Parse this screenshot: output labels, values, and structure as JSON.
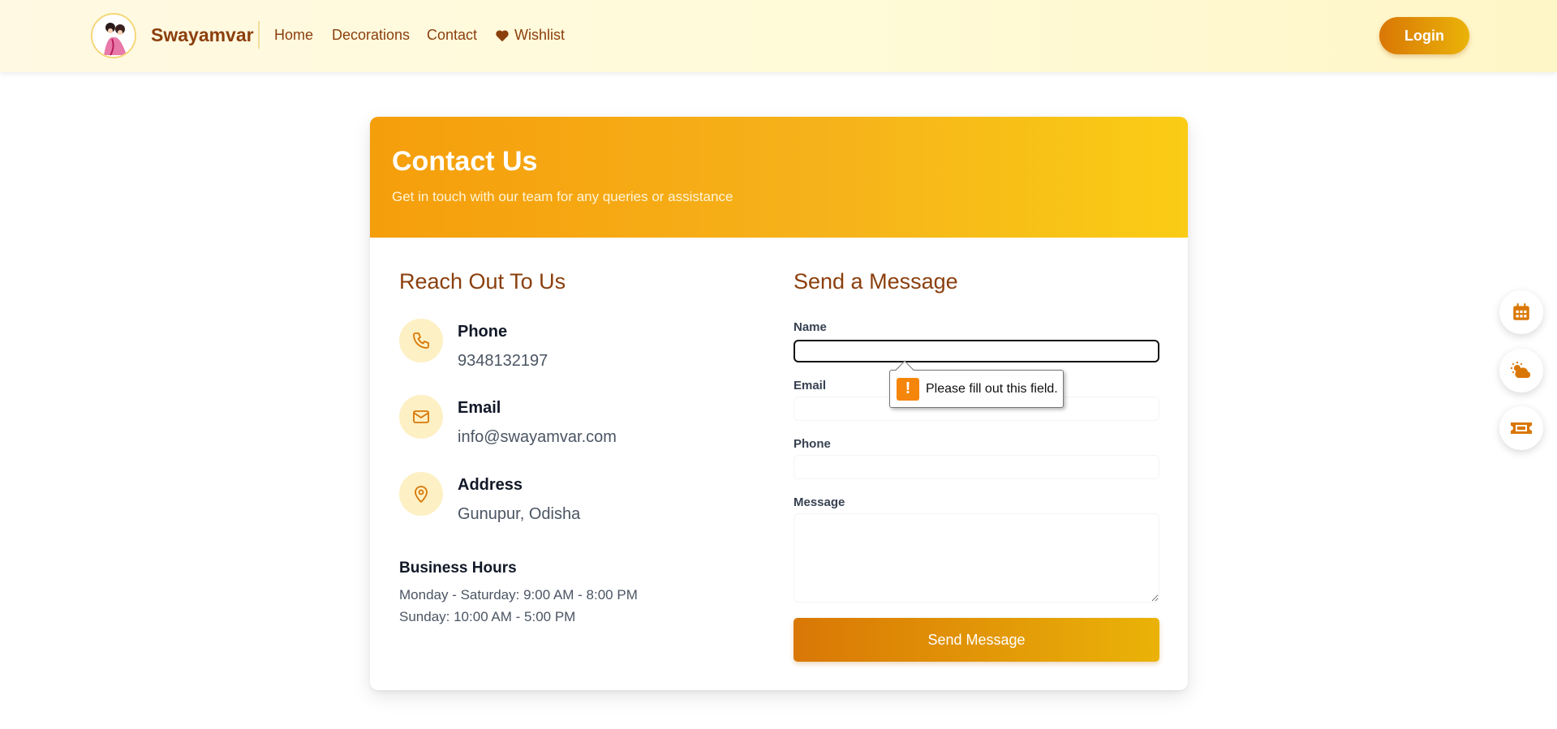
{
  "header": {
    "brand": "Swayamvar",
    "nav": [
      "Home",
      "Decorations",
      "Contact",
      "Wishlist"
    ],
    "login_label": "Login"
  },
  "contact": {
    "title": "Contact Us",
    "subtitle": "Get in touch with our team for any queries or assistance",
    "reach": {
      "title": "Reach Out To Us",
      "items": [
        {
          "label": "Phone",
          "value": "9348132197",
          "icon": "phone-icon"
        },
        {
          "label": "Email",
          "value": "info@swayamvar.com",
          "icon": "mail-icon"
        },
        {
          "label": "Address",
          "value": "Gunupur, Odisha",
          "icon": "map-pin-icon"
        }
      ],
      "hours_title": "Business Hours",
      "hours": [
        "Monday - Saturday: 9:00 AM - 8:00 PM",
        "Sunday: 10:00 AM - 5:00 PM"
      ]
    },
    "form": {
      "title": "Send a Message",
      "name_label": "Name",
      "email_label": "Email",
      "phone_label": "Phone",
      "message_label": "Message",
      "submit_label": "Send Message",
      "validation_message": "Please fill out this field."
    }
  },
  "side_buttons": [
    "calendar-icon",
    "weather-icon",
    "ticket-icon"
  ],
  "colors": {
    "accent": "#f59e0b",
    "brand_text": "#8b3f0d",
    "button_start": "#d97706",
    "button_end": "#eab308"
  }
}
